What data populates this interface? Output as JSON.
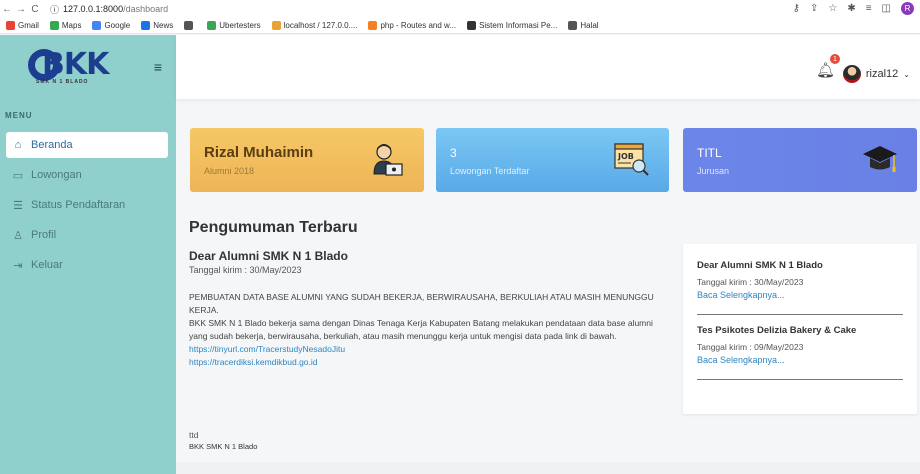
{
  "browser": {
    "url_host": "127.0.0.1:8000",
    "url_path": "/dashboard",
    "bookmarks": [
      {
        "label": "Gmail",
        "color": "#ea4335"
      },
      {
        "label": "Maps",
        "color": "#34a853"
      },
      {
        "label": "Google",
        "color": "#4285f4"
      },
      {
        "label": "News",
        "color": "#1a73e8"
      },
      {
        "label": "",
        "color": "#555555"
      },
      {
        "label": "Ubertesters",
        "color": "#3aa655"
      },
      {
        "label": "localhost / 127.0.0....",
        "color": "#e8a23a"
      },
      {
        "label": "php - Routes and w...",
        "color": "#f48024"
      },
      {
        "label": "Sistem Informasi Pe...",
        "color": "#333333"
      },
      {
        "label": "Halal",
        "color": "#555555"
      }
    ],
    "profile_initial": "R"
  },
  "sidebar": {
    "logo_text": "BKK",
    "logo_sub": "SMK N 1 BLADO",
    "menu_label": "MENU",
    "items": [
      {
        "label": "Beranda",
        "icon": "home-icon",
        "glyph": "⌂",
        "active": true
      },
      {
        "label": "Lowongan",
        "icon": "briefcase-icon",
        "glyph": "▭",
        "active": false
      },
      {
        "label": "Status Pendaftaran",
        "icon": "list-icon",
        "glyph": "☰",
        "active": false
      },
      {
        "label": "Profil",
        "icon": "user-icon",
        "glyph": "♙",
        "active": false
      },
      {
        "label": "Keluar",
        "icon": "logout-icon",
        "glyph": "⇥",
        "active": false
      }
    ]
  },
  "topbar": {
    "notification_count": "1",
    "username": "rizal12"
  },
  "cards": [
    {
      "title": "Rizal Muhaimin",
      "subtitle": "Alumni 2018",
      "icon": "graduate-person-icon"
    },
    {
      "title": "3",
      "subtitle": "Lowongan Terdaftar",
      "icon": "job-search-icon"
    },
    {
      "title": "TITL",
      "subtitle": "Jurusan",
      "icon": "graduation-cap-icon"
    }
  ],
  "announcement": {
    "section_title": "Pengumuman Terbaru",
    "title": "Dear Alumni SMK N 1 Blado",
    "date": "Tanggal kirim : 30/May/2023",
    "body_line1": "PEMBUATAN DATA BASE ALUMNI YANG SUDAH BEKERJA, BERWIRAUSAHA, BERKULIAH ATAU MASIH MENUNGGU KERJA.",
    "body_line2": "BKK SMK N 1 Blado bekerja sama dengan Dinas Tenaga Kerja Kabupaten Batang melakukan pendataan data base alumni yang sudah bekerja, berwirausaha, berkuliah, atau masih menunggu kerja untuk mengisi data pada link di bawah.",
    "link1": "https://tinyurl.com/TracerstudyNesadoJitu",
    "link2": "https://tracerdiksi.kemdikbud.go.id",
    "ttd": "ttd",
    "signature": "BKK SMK N 1 Blado"
  },
  "recent": [
    {
      "title": "Dear Alumni SMK N 1 Blado",
      "date": "Tanggal kirim : 30/May/2023",
      "link": "Baca Selengkapnya..."
    },
    {
      "title": "Tes Psikotes Delizia Bakery & Cake",
      "date": "Tanggal kirim : 09/May/2023",
      "link": "Baca Selengkapnya..."
    }
  ]
}
